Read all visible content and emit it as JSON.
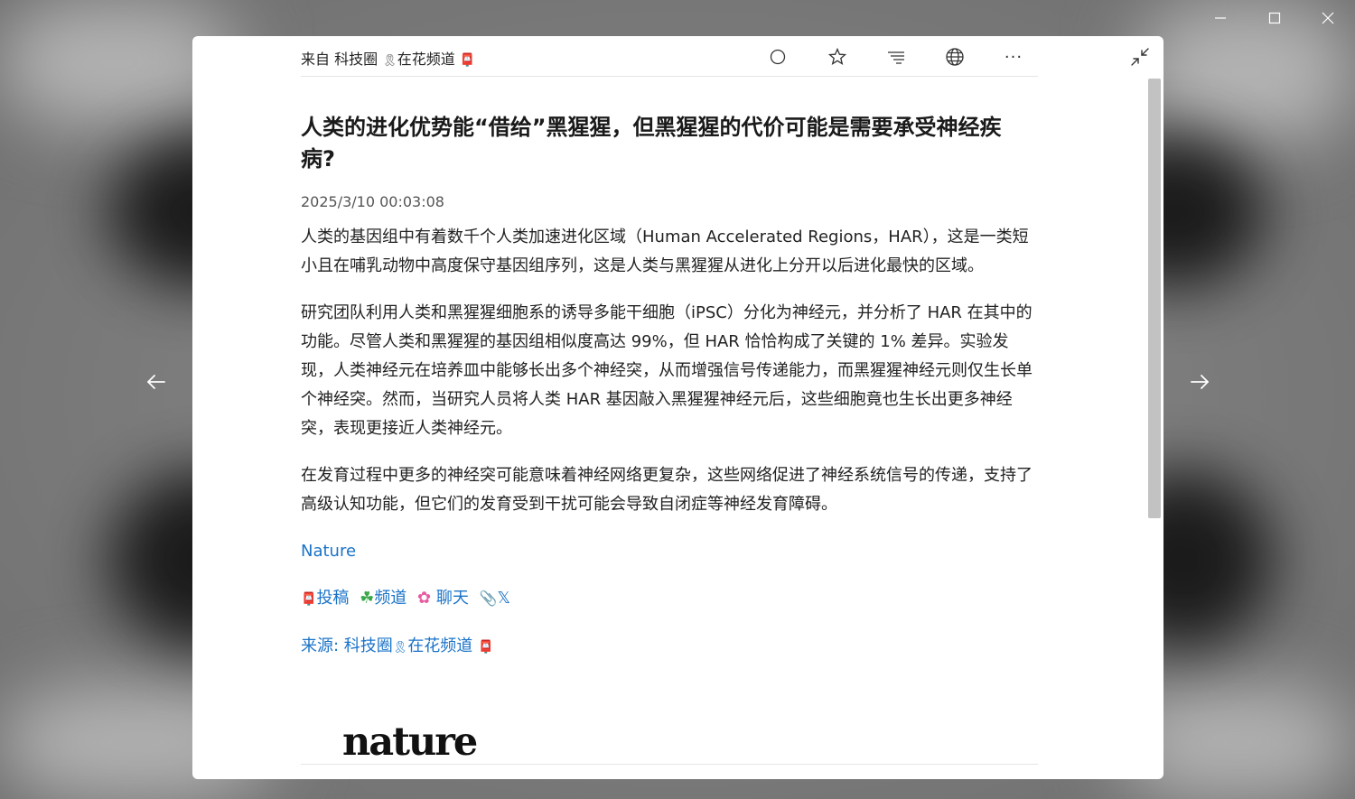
{
  "window": {
    "minimize_icon": "minimize-icon",
    "maximize_icon": "maximize-icon",
    "close_icon": "close-icon"
  },
  "navigation": {
    "prev_icon": "arrow-left-icon",
    "next_icon": "arrow-right-icon"
  },
  "toolbar": {
    "source_prefix": "来自 科技圈",
    "source_channel": "在花频道",
    "icons": [
      "circle-icon",
      "star-icon",
      "align-icon",
      "globe-icon",
      "more-icon",
      "collapse-icon"
    ],
    "more_label": "···"
  },
  "article": {
    "title": "人类的进化优势能“借给”黑猩猩，但黑猩猩的代价可能是需要承受神经疾病?",
    "date": "2025/3/10 00:03:08",
    "paragraphs": [
      "人类的基因组中有着数千个人类加速进化区域（Human Accelerated Regions，HAR），这是一类短小且在哺乳动物中高度保守基因组序列，这是人类与黑猩猩从进化上分开以后进化最快的区域。",
      "研究团队利用人类和黑猩猩细胞系的诱导多能干细胞（iPSC）分化为神经元，并分析了 HAR 在其中的功能。尽管人类和黑猩猩的基因组相似度高达 99%，但 HAR 恰恰构成了关键的 1% 差异。实验发现，人类神经元在培养皿中能够长出多个神经突，从而增强信号传递能力，而黑猩猩神经元则仅生长单个神经突。然而，当研究人员将人类 HAR 基因敲入黑猩猩神经元后，这些细胞竟也生长出更多神经突，表现更接近人类神经元。",
      "在发育过程中更多的神经突可能意味着神经网络更复杂，这些网络促进了神经系统信号的传递，支持了高级认知功能，但它们的发育受到干扰可能会导致自闭症等神经发育障碍。"
    ],
    "nature_link": "Nature",
    "tags": [
      {
        "icon": "pin-icon",
        "label": "投稿"
      },
      {
        "icon": "clover-icon",
        "label": "频道"
      },
      {
        "icon": "flower-icon",
        "label": "聊天"
      },
      {
        "icon": "paperclip-icon",
        "label": "𝕏"
      }
    ],
    "source_line_prefix": "来源: 科技圈",
    "source_line_channel": "在花频道",
    "logo_text": "nature"
  },
  "colors": {
    "link": "#1a73c8",
    "pin": "#e2324a",
    "clover": "#3aa84a",
    "flower": "#e75a9e"
  }
}
